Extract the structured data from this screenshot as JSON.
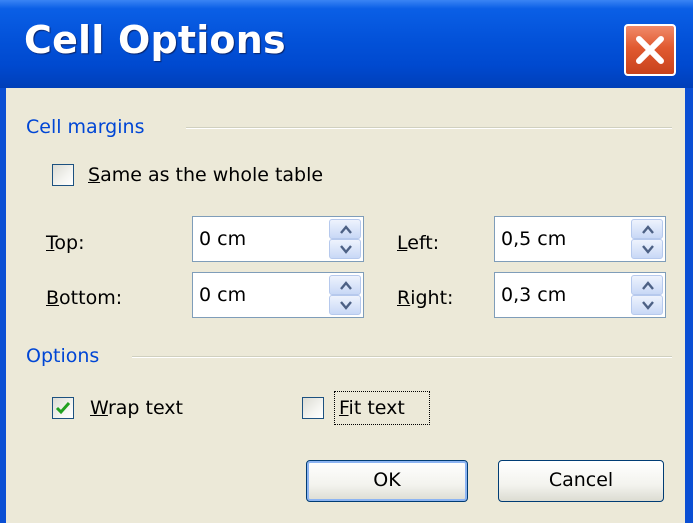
{
  "window": {
    "title": "Cell Options",
    "close_icon": "close-icon"
  },
  "cell_margins": {
    "heading": "Cell margins",
    "same_as_table": {
      "label_first": "S",
      "label_rest": "ame as the whole table",
      "checked": false
    },
    "top": {
      "label_first": "T",
      "label_rest": "op:",
      "value": "0 cm"
    },
    "bottom": {
      "label_first": "B",
      "label_rest": "ottom:",
      "value": "0 cm"
    },
    "left": {
      "label_first": "L",
      "label_rest": "eft:",
      "value": "0,5 cm"
    },
    "right": {
      "label_first": "R",
      "label_rest": "ight:",
      "value": "0,3 cm"
    }
  },
  "options": {
    "heading": "Options",
    "wrap_text": {
      "label_first": "W",
      "label_rest": "rap text",
      "checked": true
    },
    "fit_text": {
      "label_first": "F",
      "label_rest": "it text",
      "checked": false
    }
  },
  "buttons": {
    "ok": "OK",
    "cancel": "Cancel"
  },
  "colors": {
    "title_bar": "#0352d9",
    "section_heading": "#0046d5",
    "checkmark": "#21a121",
    "close_button": "#e15a30"
  }
}
